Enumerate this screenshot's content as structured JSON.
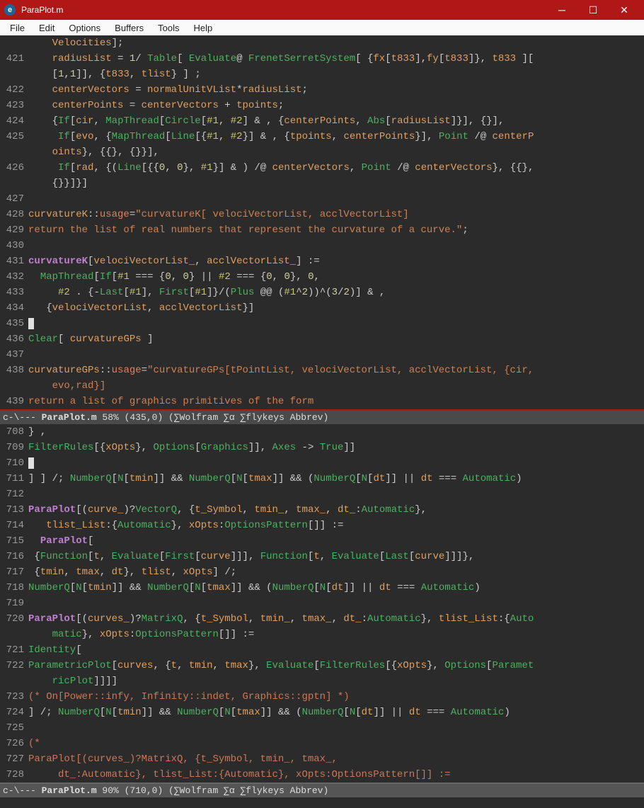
{
  "window": {
    "title": "ParaPlot.m",
    "icon_letter": "e"
  },
  "menubar": [
    "File",
    "Edit",
    "Options",
    "Buffers",
    "Tools",
    "Help"
  ],
  "pane1": {
    "lines": [
      {
        "n": "",
        "html": "    <span class='k-var'>Velocities</span><span class='k-brace'>]</span><span class='k-punct'>;</span>"
      },
      {
        "n": "421",
        "html": "    <span class='k-var'>radiusList</span> <span class='k-punct'>=</span> <span class='k-num'>1</span><span class='k-punct'>/</span> <span class='k-builtin'>Table</span><span class='k-brace'>[</span> <span class='k-builtin'>Evaluate</span><span class='k-punct'>@</span> <span class='k-builtin'>FrenetSerretSystem</span><span class='k-brace'>[</span> <span class='k-brace'>{</span><span class='k-var'>fx</span><span class='k-brace'>[</span><span class='k-var'>t833</span><span class='k-brace'>]</span><span class='k-punct'>,</span><span class='k-var'>fy</span><span class='k-brace'>[</span><span class='k-var'>t833</span><span class='k-brace'>]}</span><span class='k-punct'>,</span> <span class='k-var'>t833</span> <span class='k-brace'>][</span>"
      },
      {
        "n": "",
        "html": "    <span class='k-brace'>[</span><span class='k-num'>1</span><span class='k-punct'>,</span><span class='k-num'>1</span><span class='k-brace'>]]</span><span class='k-punct'>,</span> <span class='k-brace'>{</span><span class='k-var'>t833</span><span class='k-punct'>,</span> <span class='k-var'>tlist</span><span class='k-brace'>}</span> <span class='k-brace'>]</span> <span class='k-punct'>;</span>"
      },
      {
        "n": "422",
        "html": "    <span class='k-var'>centerVectors</span> <span class='k-punct'>=</span> <span class='k-var'>normalUnitVList</span><span class='k-punct'>*</span><span class='k-var'>radiusList</span><span class='k-punct'>;</span>"
      },
      {
        "n": "423",
        "html": "    <span class='k-var'>centerPoints</span> <span class='k-punct'>=</span> <span class='k-var'>centerVectors</span> <span class='k-punct'>+</span> <span class='k-var'>tpoints</span><span class='k-punct'>;</span>"
      },
      {
        "n": "424",
        "html": "    <span class='k-brace'>{</span><span class='k-builtin'>If</span><span class='k-brace'>[</span><span class='k-var'>cir</span><span class='k-punct'>,</span> <span class='k-builtin'>MapThread</span><span class='k-brace'>[</span><span class='k-builtin'>Circle</span><span class='k-brace'>[</span><span class='k-sym'>#1</span><span class='k-punct'>,</span> <span class='k-sym'>#2</span><span class='k-brace'>]</span> <span class='k-punct'>&amp; ,</span> <span class='k-brace'>{</span><span class='k-var'>centerPoints</span><span class='k-punct'>,</span> <span class='k-builtin'>Abs</span><span class='k-brace'>[</span><span class='k-var'>radiusList</span><span class='k-brace'>]}]</span><span class='k-punct'>,</span> <span class='k-brace'>{}]</span><span class='k-punct'>,</span>"
      },
      {
        "n": "425",
        "html": "     <span class='k-builtin'>If</span><span class='k-brace'>[</span><span class='k-var'>evo</span><span class='k-punct'>,</span> <span class='k-brace'>{</span><span class='k-builtin'>MapThread</span><span class='k-brace'>[</span><span class='k-builtin'>Line</span><span class='k-brace'>[{</span><span class='k-sym'>#1</span><span class='k-punct'>,</span> <span class='k-sym'>#2</span><span class='k-brace'>}]</span> <span class='k-punct'>&amp; ,</span> <span class='k-brace'>{</span><span class='k-var'>tpoints</span><span class='k-punct'>,</span> <span class='k-var'>centerPoints</span><span class='k-brace'>}]</span><span class='k-punct'>,</span> <span class='k-builtin'>Point</span> <span class='k-punct'>/@</span> <span class='k-var'>centerP</span>"
      },
      {
        "n": "",
        "html": "    <span class='k-var'>oints</span><span class='k-brace'>}</span><span class='k-punct'>,</span> <span class='k-brace'>{{}</span><span class='k-punct'>,</span> <span class='k-brace'>{}}]</span><span class='k-punct'>,</span>"
      },
      {
        "n": "426",
        "html": "     <span class='k-builtin'>If</span><span class='k-brace'>[</span><span class='k-var'>rad</span><span class='k-punct'>,</span> <span class='k-brace'>{(</span><span class='k-builtin'>Line</span><span class='k-brace'>[{{</span><span class='k-num'>0</span><span class='k-punct'>,</span> <span class='k-num'>0</span><span class='k-brace'>}</span><span class='k-punct'>,</span> <span class='k-sym'>#1</span><span class='k-brace'>}]</span> <span class='k-punct'>&amp; )</span> <span class='k-punct'>/@</span> <span class='k-var'>centerVectors</span><span class='k-punct'>,</span> <span class='k-builtin'>Point</span> <span class='k-punct'>/@</span> <span class='k-var'>centerVectors</span><span class='k-brace'>}</span><span class='k-punct'>,</span> <span class='k-brace'>{{}</span><span class='k-punct'>,</span>"
      },
      {
        "n": "",
        "html": "    <span class='k-brace'>{}}]}]</span>"
      },
      {
        "n": "427",
        "html": ""
      },
      {
        "n": "428",
        "html": "<span class='k-var'>curvatureK</span><span class='k-punct'>::</span><span class='k-kw'>usage</span><span class='k-punct'>=</span><span class='k-string'>\"curvatureK[ velociVectorList, acclVectorList]</span>"
      },
      {
        "n": "429",
        "html": "<span class='k-string'>return the list of real numbers that represent the curvature of a curve.\"</span><span class='k-punct'>;</span>"
      },
      {
        "n": "430",
        "html": ""
      },
      {
        "n": "431",
        "html": "<span class='k-fn'>curvatureK</span><span class='k-brace'>[</span><span class='k-var'>velociVectorList_</span><span class='k-punct'>,</span> <span class='k-var'>acclVectorList_</span><span class='k-brace'>]</span> <span class='k-punct'>:=</span>"
      },
      {
        "n": "432",
        "html": "  <span class='k-builtin'>MapThread</span><span class='k-brace'>[</span><span class='k-builtin'>If</span><span class='k-brace'>[</span><span class='k-sym'>#1</span> <span class='k-punct'>===</span> <span class='k-brace'>{</span><span class='k-num'>0</span><span class='k-punct'>,</span> <span class='k-num'>0</span><span class='k-brace'>}</span> <span class='k-punct'>||</span> <span class='k-sym'>#2</span> <span class='k-punct'>===</span> <span class='k-brace'>{</span><span class='k-num'>0</span><span class='k-punct'>,</span> <span class='k-num'>0</span><span class='k-brace'>}</span><span class='k-punct'>,</span> <span class='k-num'>0</span><span class='k-punct'>,</span>"
      },
      {
        "n": "433",
        "html": "     <span class='k-sym'>#2</span> <span class='k-punct'>.</span> <span class='k-brace'>{</span><span class='k-punct'>-</span><span class='k-builtin'>Last</span><span class='k-brace'>[</span><span class='k-sym'>#1</span><span class='k-brace'>]</span><span class='k-punct'>,</span> <span class='k-builtin'>First</span><span class='k-brace'>[</span><span class='k-sym'>#1</span><span class='k-brace'>]}</span><span class='k-punct'>/</span><span class='k-brace'>(</span><span class='k-builtin'>Plus</span> <span class='k-punct'>@@</span> <span class='k-brace'>(</span><span class='k-sym'>#1</span><span class='k-punct'>^</span><span class='k-num'>2</span><span class='k-brace'>))</span><span class='k-punct'>^</span><span class='k-brace'>(</span><span class='k-num'>3</span><span class='k-punct'>/</span><span class='k-num'>2</span><span class='k-brace'>)]</span> <span class='k-punct'>&amp; ,</span>"
      },
      {
        "n": "434",
        "html": "   <span class='k-brace'>{</span><span class='k-var'>velociVectorList</span><span class='k-punct'>,</span> <span class='k-var'>acclVectorList</span><span class='k-brace'>}]</span>"
      },
      {
        "n": "435",
        "html": "<span class='cursor'> </span>"
      },
      {
        "n": "436",
        "html": "<span class='k-builtin'>Clear</span><span class='k-brace'>[</span> <span class='k-var'>curvatureGPs</span> <span class='k-brace'>]</span>"
      },
      {
        "n": "437",
        "html": ""
      },
      {
        "n": "438",
        "html": "<span class='k-var'>curvatureGPs</span><span class='k-punct'>::</span><span class='k-kw'>usage</span><span class='k-punct'>=</span><span class='k-string'>\"curvatureGPs[tPointList, velociVectorList, acclVectorList, {cir,</span>"
      },
      {
        "n": "",
        "html": "    <span class='k-string'>evo,rad}]</span>"
      },
      {
        "n": "439",
        "html": "<span class='k-string'>return a list of graphics primitives of the form</span>"
      }
    ],
    "modeline": "c-\\--- <b>ParaPlot.m</b> 58% (435,0) (∑Wolfram ∑α ∑flykeys Abbrev)"
  },
  "pane2": {
    "lines": [
      {
        "n": "708",
        "html": "<span class='k-brace'>}</span> <span class='k-punct'>,</span>"
      },
      {
        "n": "709",
        "html": "<span class='k-builtin'>FilterRules</span><span class='k-brace'>[{</span><span class='k-var'>xOpts</span><span class='k-brace'>}</span><span class='k-punct'>,</span> <span class='k-builtin'>Options</span><span class='k-brace'>[</span><span class='k-builtin'>Graphics</span><span class='k-brace'>]]</span><span class='k-punct'>,</span> <span class='k-builtin'>Axes</span> <span class='k-punct'>-&gt;</span> <span class='k-builtin'>True</span><span class='k-brace'>]]</span>"
      },
      {
        "n": "710",
        "html": "<span class='cursor'> </span>"
      },
      {
        "n": "711",
        "html": "<span class='k-brace'>] ]</span> <span class='k-punct'>/;</span> <span class='k-builtin'>NumberQ</span><span class='k-brace'>[</span><span class='k-builtin'>N</span><span class='k-brace'>[</span><span class='k-var'>tmin</span><span class='k-brace'>]]</span> <span class='k-punct'>&amp;&amp;</span> <span class='k-builtin'>NumberQ</span><span class='k-brace'>[</span><span class='k-builtin'>N</span><span class='k-brace'>[</span><span class='k-var'>tmax</span><span class='k-brace'>]]</span> <span class='k-punct'>&amp;&amp;</span> <span class='k-brace'>(</span><span class='k-builtin'>NumberQ</span><span class='k-brace'>[</span><span class='k-builtin'>N</span><span class='k-brace'>[</span><span class='k-var'>dt</span><span class='k-brace'>]]</span> <span class='k-punct'>||</span> <span class='k-var'>dt</span> <span class='k-punct'>===</span> <span class='k-builtin'>Automatic</span><span class='k-brace'>)</span>"
      },
      {
        "n": "712",
        "html": ""
      },
      {
        "n": "713",
        "html": "<span class='k-fn'>ParaPlot</span><span class='k-brace'>[(</span><span class='k-var'>curve_</span><span class='k-brace'>)</span><span class='k-punct'>?</span><span class='k-builtin'>VectorQ</span><span class='k-punct'>,</span> <span class='k-brace'>{</span><span class='k-var'>t_Symbol</span><span class='k-punct'>,</span> <span class='k-var'>tmin_</span><span class='k-punct'>,</span> <span class='k-var'>tmax_</span><span class='k-punct'>,</span> <span class='k-var'>dt_</span><span class='k-punct'>:</span><span class='k-builtin'>Automatic</span><span class='k-brace'>}</span><span class='k-punct'>,</span>"
      },
      {
        "n": "714",
        "html": "   <span class='k-var'>tlist_List</span><span class='k-punct'>:</span><span class='k-brace'>{</span><span class='k-builtin'>Automatic</span><span class='k-brace'>}</span><span class='k-punct'>,</span> <span class='k-var'>xOpts</span><span class='k-punct'>:</span><span class='k-builtin'>OptionsPattern</span><span class='k-brace'>[]]</span> <span class='k-punct'>:=</span>"
      },
      {
        "n": "715",
        "html": "  <span class='k-fn'>ParaPlot</span><span class='k-brace'>[</span>"
      },
      {
        "n": "716",
        "html": " <span class='k-brace'>{</span><span class='k-builtin'>Function</span><span class='k-brace'>[</span><span class='k-var'>t</span><span class='k-punct'>,</span> <span class='k-builtin'>Evaluate</span><span class='k-brace'>[</span><span class='k-builtin'>First</span><span class='k-brace'>[</span><span class='k-var'>curve</span><span class='k-brace'>]]]</span><span class='k-punct'>,</span> <span class='k-builtin'>Function</span><span class='k-brace'>[</span><span class='k-var'>t</span><span class='k-punct'>,</span> <span class='k-builtin'>Evaluate</span><span class='k-brace'>[</span><span class='k-builtin'>Last</span><span class='k-brace'>[</span><span class='k-var'>curve</span><span class='k-brace'>]]]}</span><span class='k-punct'>,</span>"
      },
      {
        "n": "717",
        "html": " <span class='k-brace'>{</span><span class='k-var'>tmin</span><span class='k-punct'>,</span> <span class='k-var'>tmax</span><span class='k-punct'>,</span> <span class='k-var'>dt</span><span class='k-brace'>}</span><span class='k-punct'>,</span> <span class='k-var'>tlist</span><span class='k-punct'>,</span> <span class='k-var'>xOpts</span><span class='k-brace'>]</span> <span class='k-punct'>/;</span>"
      },
      {
        "n": "718",
        "html": "<span class='k-builtin'>NumberQ</span><span class='k-brace'>[</span><span class='k-builtin'>N</span><span class='k-brace'>[</span><span class='k-var'>tmin</span><span class='k-brace'>]]</span> <span class='k-punct'>&amp;&amp;</span> <span class='k-builtin'>NumberQ</span><span class='k-brace'>[</span><span class='k-builtin'>N</span><span class='k-brace'>[</span><span class='k-var'>tmax</span><span class='k-brace'>]]</span> <span class='k-punct'>&amp;&amp;</span> <span class='k-brace'>(</span><span class='k-builtin'>NumberQ</span><span class='k-brace'>[</span><span class='k-builtin'>N</span><span class='k-brace'>[</span><span class='k-var'>dt</span><span class='k-brace'>]]</span> <span class='k-punct'>||</span> <span class='k-var'>dt</span> <span class='k-punct'>===</span> <span class='k-builtin'>Automatic</span><span class='k-brace'>)</span>"
      },
      {
        "n": "719",
        "html": ""
      },
      {
        "n": "720",
        "html": "<span class='k-fn'>ParaPlot</span><span class='k-brace'>[(</span><span class='k-var'>curves_</span><span class='k-brace'>)</span><span class='k-punct'>?</span><span class='k-builtin'>MatrixQ</span><span class='k-punct'>,</span> <span class='k-brace'>{</span><span class='k-var'>t_Symbol</span><span class='k-punct'>,</span> <span class='k-var'>tmin_</span><span class='k-punct'>,</span> <span class='k-var'>tmax_</span><span class='k-punct'>,</span> <span class='k-var'>dt_</span><span class='k-punct'>:</span><span class='k-builtin'>Automatic</span><span class='k-brace'>}</span><span class='k-punct'>,</span> <span class='k-var'>tlist_List</span><span class='k-punct'>:</span><span class='k-brace'>{</span><span class='k-builtin'>Auto</span>"
      },
      {
        "n": "",
        "html": "    <span class='k-builtin'>matic</span><span class='k-brace'>}</span><span class='k-punct'>,</span> <span class='k-var'>xOpts</span><span class='k-punct'>:</span><span class='k-builtin'>OptionsPattern</span><span class='k-brace'>[]]</span> <span class='k-punct'>:=</span>"
      },
      {
        "n": "721",
        "html": "<span class='k-builtin'>Identity</span><span class='k-brace'>[</span>"
      },
      {
        "n": "722",
        "html": "<span class='k-builtin'>ParametricPlot</span><span class='k-brace'>[</span><span class='k-var'>curves</span><span class='k-punct'>,</span> <span class='k-brace'>{</span><span class='k-var'>t</span><span class='k-punct'>,</span> <span class='k-var'>tmin</span><span class='k-punct'>,</span> <span class='k-var'>tmax</span><span class='k-brace'>}</span><span class='k-punct'>,</span> <span class='k-builtin'>Evaluate</span><span class='k-brace'>[</span><span class='k-builtin'>FilterRules</span><span class='k-brace'>[{</span><span class='k-var'>xOpts</span><span class='k-brace'>}</span><span class='k-punct'>,</span> <span class='k-builtin'>Options</span><span class='k-brace'>[</span><span class='k-builtin'>Paramet</span>"
      },
      {
        "n": "",
        "html": "    <span class='k-builtin'>ricPlot</span><span class='k-brace'>]]]]</span>"
      },
      {
        "n": "723",
        "html": "<span class='k-comment'>(* On[Power::infy, Infinity::indet, Graphics::gptn] *)</span>"
      },
      {
        "n": "724",
        "html": "<span class='k-brace'>]</span> <span class='k-punct'>/;</span> <span class='k-builtin'>NumberQ</span><span class='k-brace'>[</span><span class='k-builtin'>N</span><span class='k-brace'>[</span><span class='k-var'>tmin</span><span class='k-brace'>]]</span> <span class='k-punct'>&amp;&amp;</span> <span class='k-builtin'>NumberQ</span><span class='k-brace'>[</span><span class='k-builtin'>N</span><span class='k-brace'>[</span><span class='k-var'>tmax</span><span class='k-brace'>]]</span> <span class='k-punct'>&amp;&amp;</span> <span class='k-brace'>(</span><span class='k-builtin'>NumberQ</span><span class='k-brace'>[</span><span class='k-builtin'>N</span><span class='k-brace'>[</span><span class='k-var'>dt</span><span class='k-brace'>]]</span> <span class='k-punct'>||</span> <span class='k-var'>dt</span> <span class='k-punct'>===</span> <span class='k-builtin'>Automatic</span><span class='k-brace'>)</span>"
      },
      {
        "n": "725",
        "html": ""
      },
      {
        "n": "726",
        "html": "<span class='k-comment'>(*</span>"
      },
      {
        "n": "727",
        "html": "<span class='k-comment'>ParaPlot[(curves_)?MatrixQ, {t_Symbol, tmin_, tmax_,</span>"
      },
      {
        "n": "728",
        "html": "<span class='k-comment'>     dt_:Automatic}, tlist_List:{Automatic}, xOpts:OptionsPattern[]] :=</span>"
      }
    ],
    "modeline": "c-\\--- <b>ParaPlot.m</b> 90% (710,0) (∑Wolfram ∑α ∑flykeys Abbrev)"
  }
}
